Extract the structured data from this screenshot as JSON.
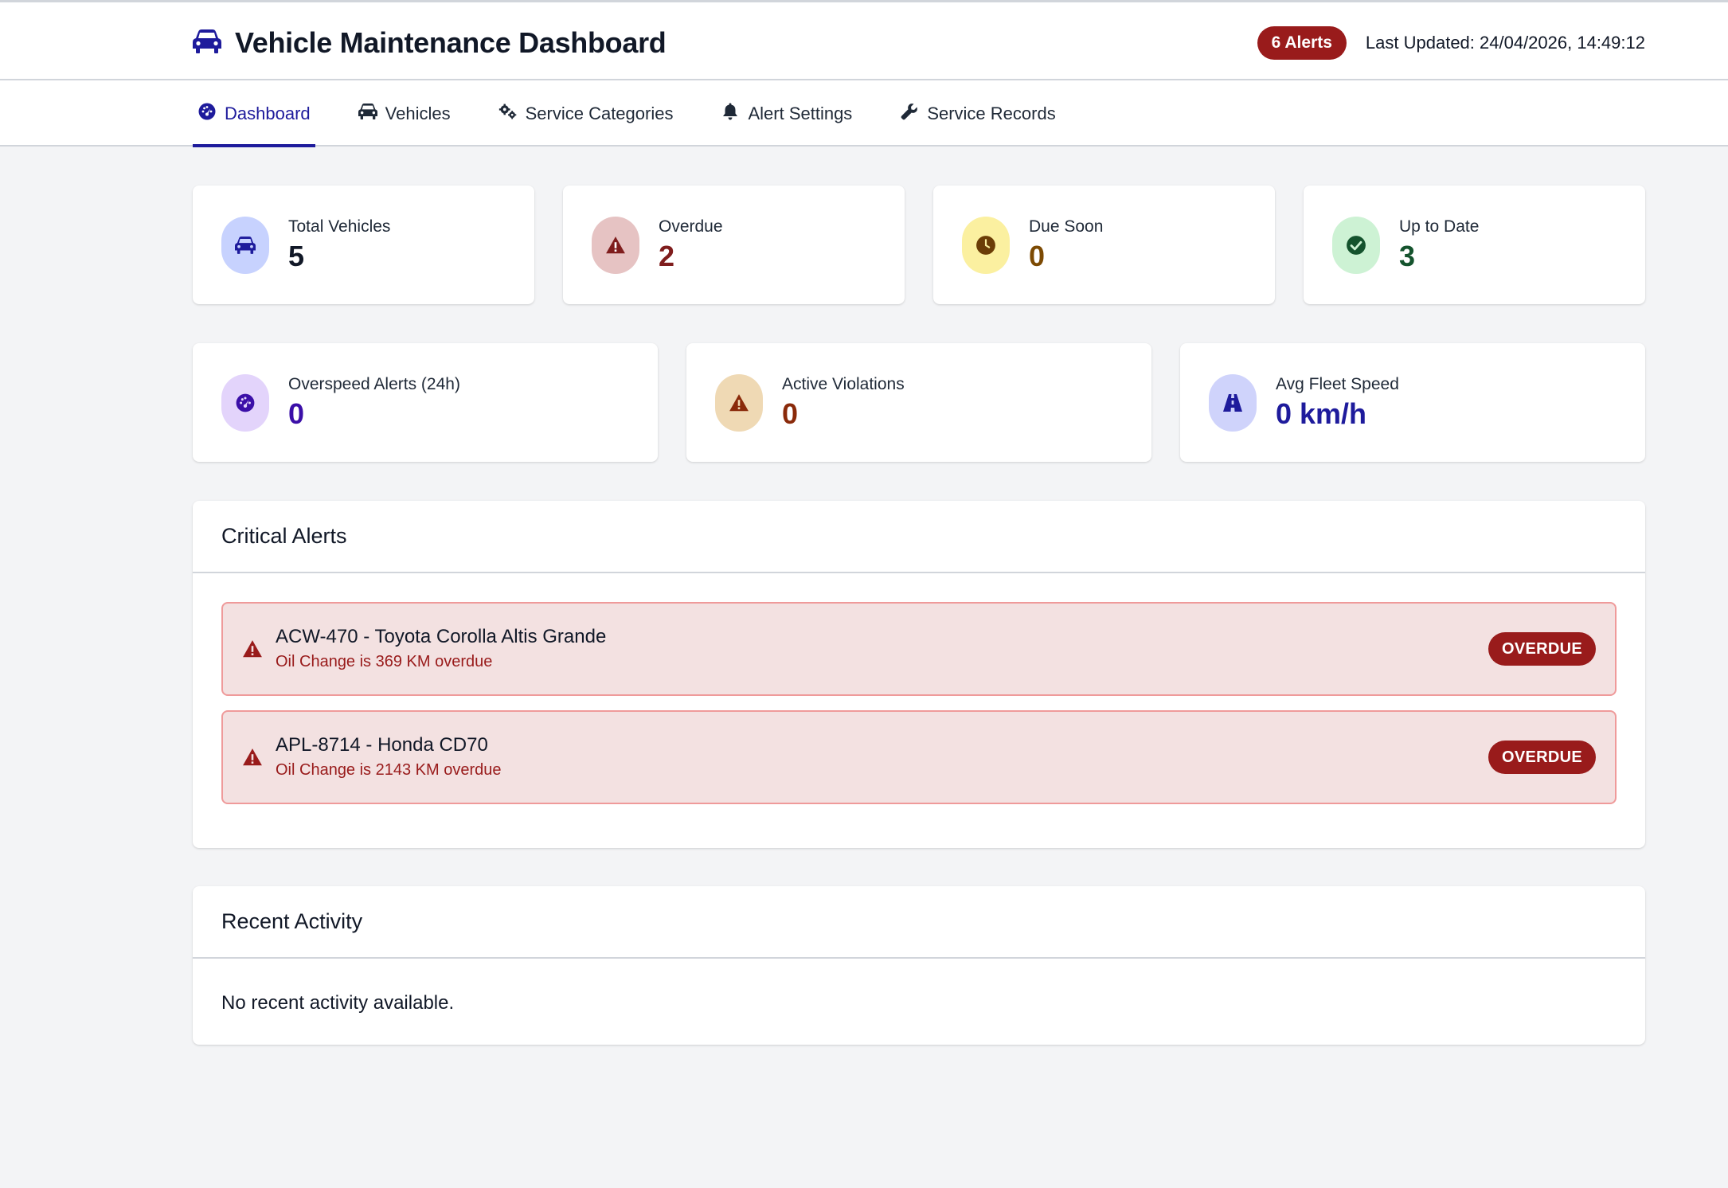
{
  "header": {
    "title": "Vehicle Maintenance Dashboard",
    "alerts_badge": "6 Alerts",
    "last_updated": "Last Updated: 24/04/2026, 14:49:12"
  },
  "nav": {
    "tabs": [
      {
        "label": "Dashboard",
        "icon": "gauge-icon",
        "active": true
      },
      {
        "label": "Vehicles",
        "icon": "car-icon"
      },
      {
        "label": "Service Categories",
        "icon": "gears-icon"
      },
      {
        "label": "Alert Settings",
        "icon": "bell-icon"
      },
      {
        "label": "Service Records",
        "icon": "wrench-icon"
      }
    ]
  },
  "stats": {
    "total_vehicles": {
      "label": "Total Vehicles",
      "value": "5",
      "icon": "car-icon",
      "color": "#1e1b9c",
      "bg": "#c7d2fe"
    },
    "overdue": {
      "label": "Overdue",
      "value": "2",
      "icon": "warning-icon",
      "color": "#7f1d1d",
      "bg": "#e6c3c3"
    },
    "due_soon": {
      "label": "Due Soon",
      "value": "0",
      "icon": "clock-icon",
      "color": "#7c4a03",
      "bg": "#fbf0a0"
    },
    "up_to_date": {
      "label": "Up to Date",
      "value": "3",
      "icon": "check-circle-icon",
      "color": "#14532d",
      "bg": "#cdf2d4"
    },
    "overspeed": {
      "label": "Overspeed Alerts (24h)",
      "value": "0",
      "icon": "gauge-icon",
      "color": "#3b0fa8",
      "bg": "#e3d4fb"
    },
    "violations": {
      "label": "Active Violations",
      "value": "0",
      "icon": "warning-icon",
      "color": "#8a2a0a",
      "bg": "#efd9b4"
    },
    "avg_speed": {
      "label": "Avg Fleet Speed",
      "value": "0 km/h",
      "icon": "road-icon",
      "color": "#1e1b9c",
      "bg": "#cfd3fb"
    }
  },
  "critical_alerts": {
    "title": "Critical Alerts",
    "items": [
      {
        "title": "ACW-470 - Toyota Corolla Altis Grande",
        "detail": "Oil Change is 369 KM overdue",
        "status": "OVERDUE"
      },
      {
        "title": "APL-8714 - Honda CD70",
        "detail": "Oil Change is 2143 KM overdue",
        "status": "OVERDUE"
      }
    ]
  },
  "recent_activity": {
    "title": "Recent Activity",
    "empty_text": "No recent activity available."
  },
  "colors": {
    "accent": "#1e1b9c",
    "danger": "#991b1b"
  }
}
